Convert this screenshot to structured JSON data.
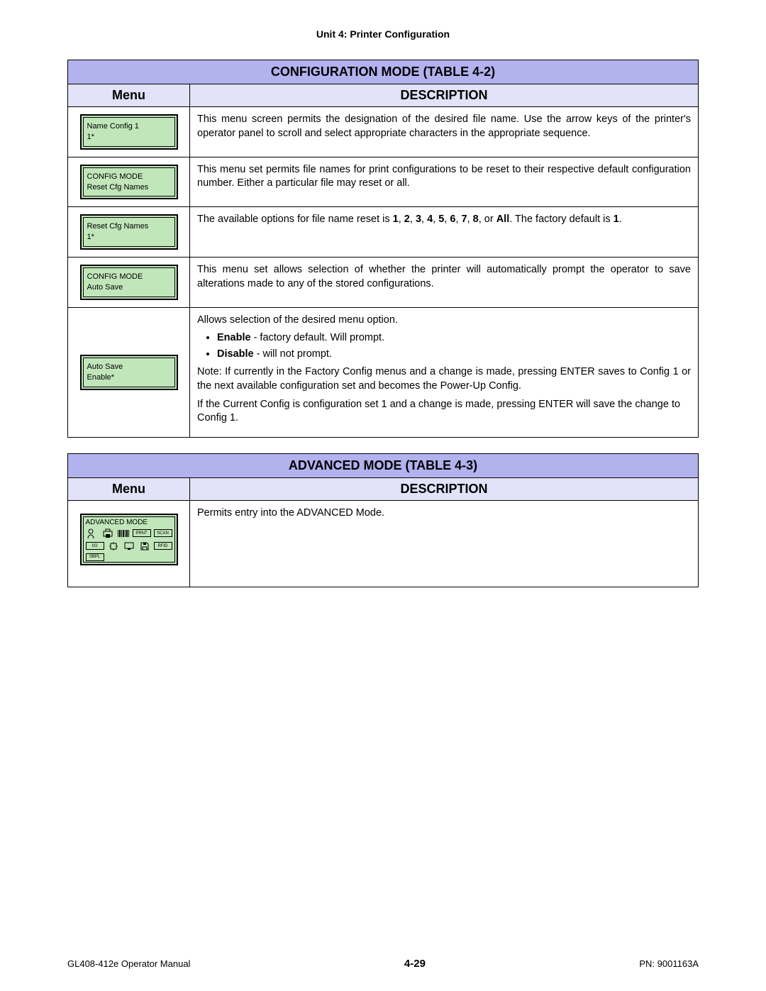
{
  "unit_header": "Unit 4:  Printer Configuration",
  "table1": {
    "title": "CONFIGURATION MODE (TABLE 4-2)",
    "col_menu": "Menu",
    "col_desc": "DESCRIPTION",
    "rows": [
      {
        "lcd_line1": "Name Config 1",
        "lcd_line2": "1*",
        "desc": "This menu screen permits the designation of the desired file name. Use the arrow keys of the printer's operator panel to scroll and select appropriate characters in the appropriate sequence."
      },
      {
        "lcd_line1": "CONFIG MODE",
        "lcd_line2": "Reset Cfg Names",
        "desc": "This menu set permits file names for print configurations to be reset to their respective default configuration number. Either a particular file may reset or all."
      },
      {
        "lcd_line1": "Reset Cfg Names",
        "lcd_line2": "1*",
        "desc_pre": "The available options for file name reset is ",
        "opts": [
          "1",
          "2",
          "3",
          "4",
          "5",
          "6",
          "7",
          "8"
        ],
        "opt_all": "All",
        "desc_mid": ". The factory default is ",
        "def": "1",
        "desc_post": "."
      },
      {
        "lcd_line1": "CONFIG MODE",
        "lcd_line2": "Auto Save",
        "desc": "This menu set allows selection of whether the printer will automatically prompt the operator to save alterations made to any of the stored configurations."
      },
      {
        "lcd_line1": "Auto Save",
        "lcd_line2": "Enable*",
        "p1": "Allows selection of the desired menu option.",
        "b1_lbl": "Enable",
        "b1_txt": " - factory default. Will prompt.",
        "b2_lbl": "Disable",
        "b2_txt": " -  will not prompt.",
        "p2": "Note: If currently in the Factory Config menus and a change is made, pressing ENTER saves to Config 1 or the next available configuration set and becomes the Power-Up Config.",
        "p3": "If the Current Config is configuration set 1 and a change is made, pressing ENTER will save the change to Config 1."
      }
    ]
  },
  "table2": {
    "title": "ADVANCED MODE (TABLE 4-3)",
    "col_menu": "Menu",
    "col_desc": "DESCRIPTION",
    "row": {
      "lcd_title": "ADVANCED MODE",
      "icons": {
        "i1": "PRNT",
        "i2": "SCAN",
        "i3": "I/O",
        "i4": "RFID",
        "i5": "SBPL"
      },
      "desc": "Permits entry into the ADVANCED Mode."
    }
  },
  "footer": {
    "left": "GL408-412e Operator Manual",
    "center": "4-29",
    "right": "PN: 9001163A"
  }
}
